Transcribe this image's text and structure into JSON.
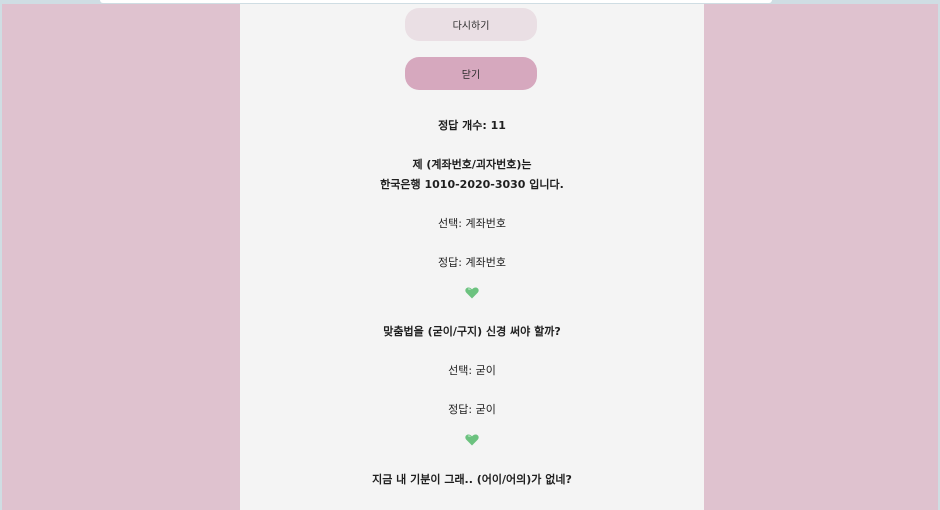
{
  "buttons": {
    "retry_label": "다시하기",
    "close_label": "닫기"
  },
  "score": {
    "text": "정답 개수: 11"
  },
  "questions": [
    {
      "prompt_line1": "제 (계좌번호/괴자번호)는",
      "prompt_line2": "한국은행 1010-2020-3030 입니다.",
      "selected": "선택: 계좌번호",
      "answer": "정답: 계좌번호",
      "result_icon": "green-heart-icon"
    },
    {
      "prompt_line1": "맞춤법을 (굳이/구지) 신경 써야 할까?",
      "selected": "선택: 굳이",
      "answer": "정답: 굳이",
      "result_icon": "green-heart-icon"
    },
    {
      "prompt_line1": "지금 내 기분이 그래.. (어이/어의)가 없네?"
    }
  ],
  "colors": {
    "page_background": "#dfc2cf",
    "panel_background": "#f4f4f4",
    "retry_button": "#eadfe4",
    "close_button": "#d6a8be",
    "heart": "#6cc27f"
  }
}
